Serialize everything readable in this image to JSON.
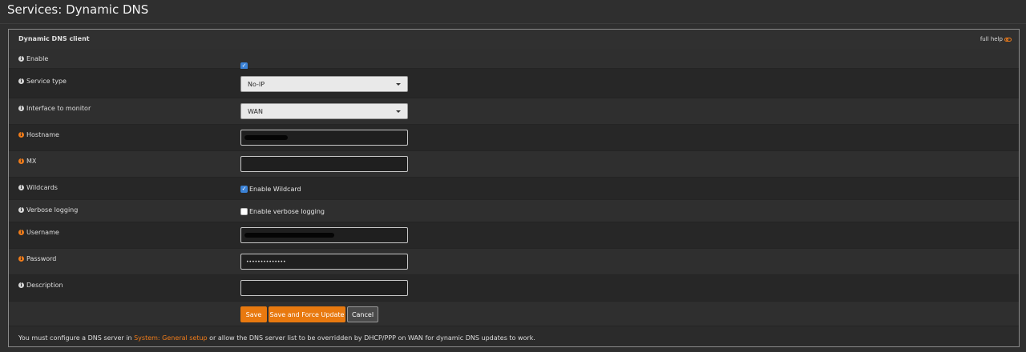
{
  "page": {
    "title": "Services: Dynamic DNS"
  },
  "panel": {
    "title": "Dynamic DNS client",
    "full_help": "full help"
  },
  "fields": {
    "enable": {
      "label": "Enable",
      "checked": true
    },
    "service_type": {
      "label": "Service type",
      "value": "No-IP"
    },
    "interface": {
      "label": "Interface to monitor",
      "value": "WAN"
    },
    "hostname": {
      "label": "Hostname",
      "value": ""
    },
    "mx": {
      "label": "MX",
      "value": ""
    },
    "wildcards": {
      "label": "Wildcards",
      "checkbox_label": "Enable Wildcard",
      "checked": true
    },
    "verbose": {
      "label": "Verbose logging",
      "checkbox_label": "Enable verbose logging",
      "checked": false
    },
    "username": {
      "label": "Username",
      "value": ""
    },
    "password": {
      "label": "Password",
      "value": "••••••••••••••"
    },
    "description": {
      "label": "Description",
      "value": ""
    }
  },
  "buttons": {
    "save": "Save",
    "save_force": "Save and Force Update",
    "cancel": "Cancel"
  },
  "footer": {
    "before": "You must configure a DNS server in ",
    "link": "System: General setup",
    "after": " or allow the DNS server list to be overridden by DHCP/PPP on WAN for dynamic DNS updates to work."
  },
  "colors": {
    "accent": "#e8790f",
    "checkbox": "#3b82d6"
  },
  "icons": {
    "info": "info-circle-icon",
    "required": "info-circle-required-icon",
    "help_toggle": "toggle-icon",
    "dropdown": "caret-down-icon",
    "check": "checkmark-icon"
  }
}
